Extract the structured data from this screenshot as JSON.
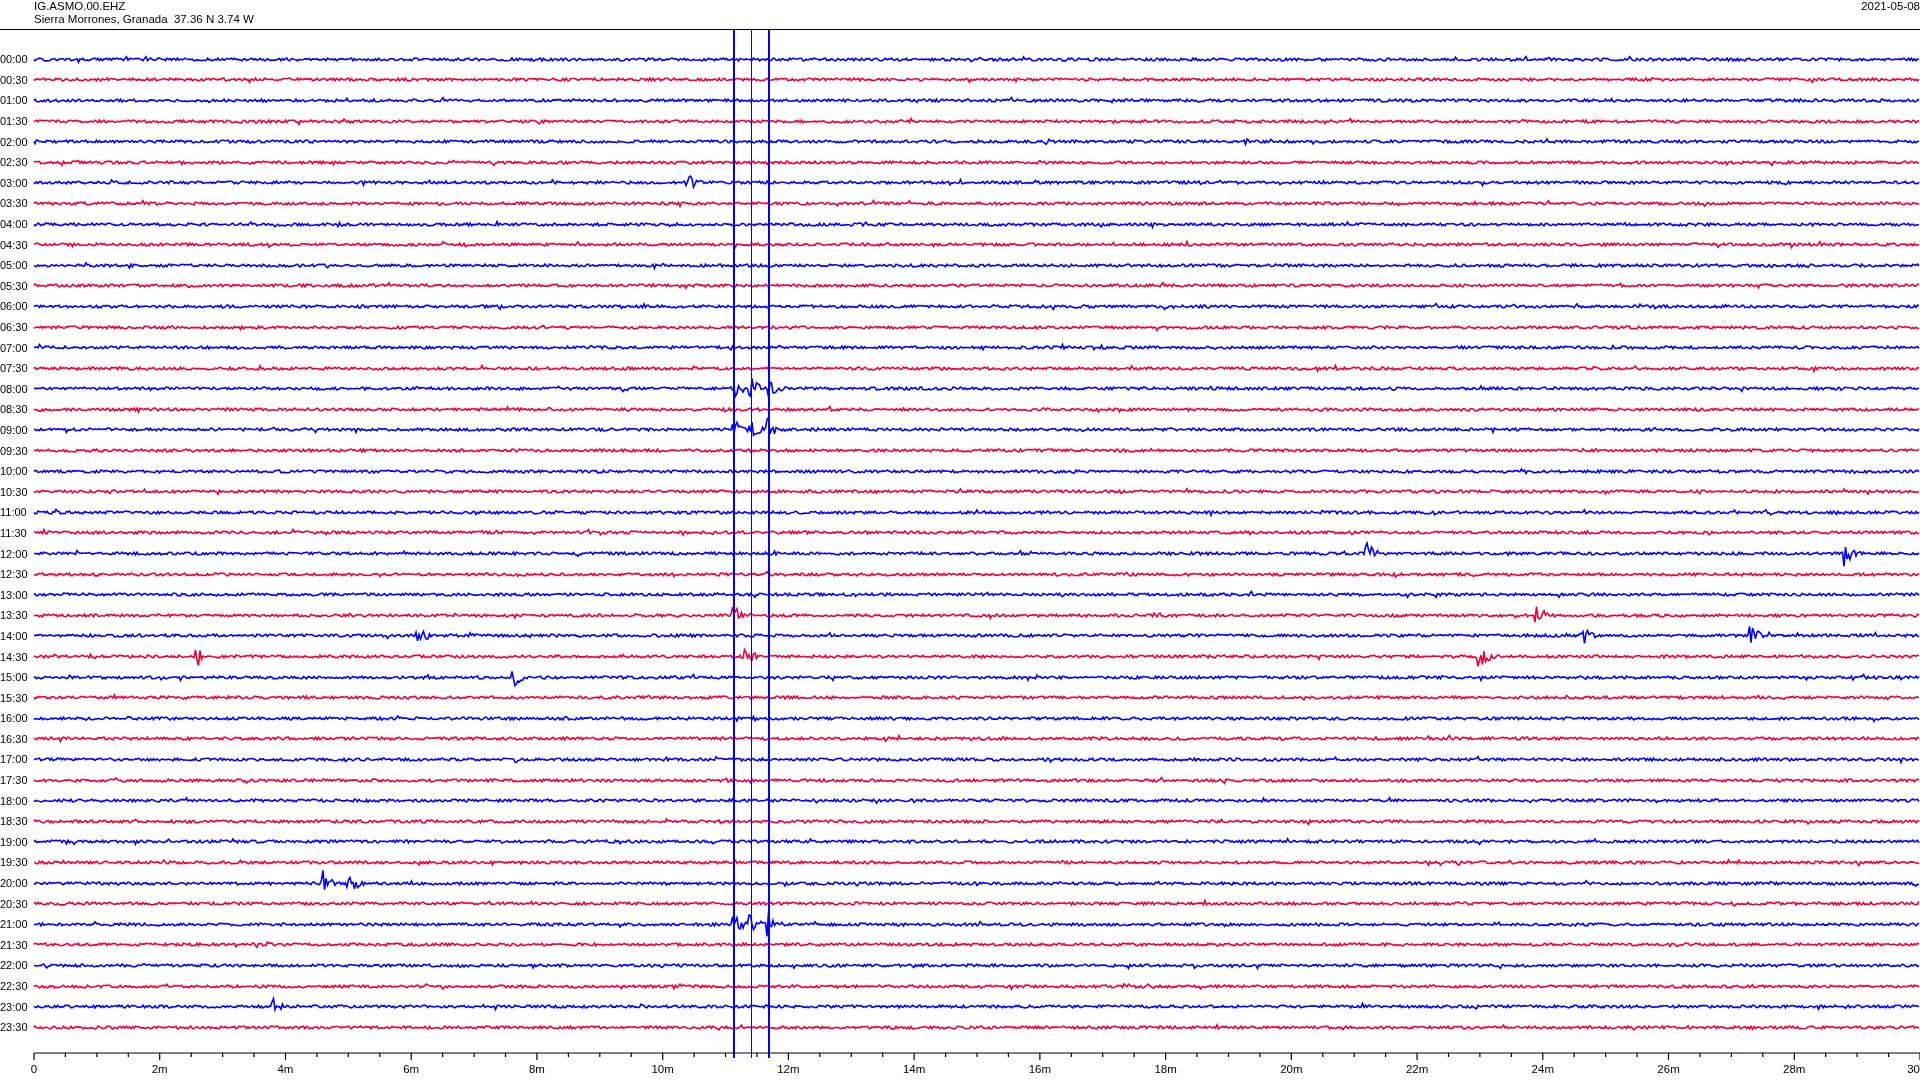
{
  "station": {
    "code": "IG.ASMO.00.EHZ",
    "location": "Sierra Morrones, Granada  37.36 N 3.74 W",
    "date": "2021-05-08"
  },
  "traces": [
    {
      "label": "00:00",
      "color": "#0000ff"
    },
    {
      "label": "00:30",
      "color": "#ee0033"
    },
    {
      "label": "01:00",
      "color": "#0000ff"
    },
    {
      "label": "01:30",
      "color": "#ee0033"
    },
    {
      "label": "02:00",
      "color": "#0000ff"
    },
    {
      "label": "02:30",
      "color": "#ee0033"
    },
    {
      "label": "03:00",
      "color": "#0000ff"
    },
    {
      "label": "03:30",
      "color": "#ee0033"
    },
    {
      "label": "04:00",
      "color": "#0000ff"
    },
    {
      "label": "04:30",
      "color": "#ee0033"
    },
    {
      "label": "05:00",
      "color": "#0000ff"
    },
    {
      "label": "05:30",
      "color": "#ee0033"
    },
    {
      "label": "06:00",
      "color": "#0000ff"
    },
    {
      "label": "06:30",
      "color": "#ee0033"
    },
    {
      "label": "07:00",
      "color": "#0000ff"
    },
    {
      "label": "07:30",
      "color": "#ee0033"
    },
    {
      "label": "08:00",
      "color": "#0000ff"
    },
    {
      "label": "08:30",
      "color": "#ee0033"
    },
    {
      "label": "09:00",
      "color": "#0000ff"
    },
    {
      "label": "09:30",
      "color": "#ee0033"
    },
    {
      "label": "10:00",
      "color": "#0000ff"
    },
    {
      "label": "10:30",
      "color": "#ee0033"
    },
    {
      "label": "11:00",
      "color": "#0000ff"
    },
    {
      "label": "11:30",
      "color": "#ee0033"
    },
    {
      "label": "12:00",
      "color": "#0000ff"
    },
    {
      "label": "12:30",
      "color": "#ee0033"
    },
    {
      "label": "13:00",
      "color": "#0000ff"
    },
    {
      "label": "13:30",
      "color": "#ee0033"
    },
    {
      "label": "14:00",
      "color": "#0000ff"
    },
    {
      "label": "14:30",
      "color": "#ee0033"
    },
    {
      "label": "15:00",
      "color": "#0000ff"
    },
    {
      "label": "15:30",
      "color": "#ee0033"
    },
    {
      "label": "16:00",
      "color": "#0000ff"
    },
    {
      "label": "16:30",
      "color": "#ee0033"
    },
    {
      "label": "17:00",
      "color": "#0000ff"
    },
    {
      "label": "17:30",
      "color": "#ee0033"
    },
    {
      "label": "18:00",
      "color": "#0000ff"
    },
    {
      "label": "18:30",
      "color": "#ee0033"
    },
    {
      "label": "19:00",
      "color": "#0000ff"
    },
    {
      "label": "19:30",
      "color": "#ee0033"
    },
    {
      "label": "20:00",
      "color": "#0000ff"
    },
    {
      "label": "20:30",
      "color": "#ee0033"
    },
    {
      "label": "21:00",
      "color": "#0000ff"
    },
    {
      "label": "21:30",
      "color": "#ee0033"
    },
    {
      "label": "22:00",
      "color": "#0000ff"
    },
    {
      "label": "22:30",
      "color": "#ee0033"
    },
    {
      "label": "23:00",
      "color": "#0000ff"
    },
    {
      "label": "23:30",
      "color": "#ee0033"
    }
  ],
  "time_axis": {
    "labels": [
      "0",
      "2m",
      "4m",
      "6m",
      "8m",
      "10m",
      "12m",
      "14m",
      "16m",
      "18m",
      "20m",
      "22m",
      "24m",
      "26m",
      "28m",
      "30"
    ]
  }
}
